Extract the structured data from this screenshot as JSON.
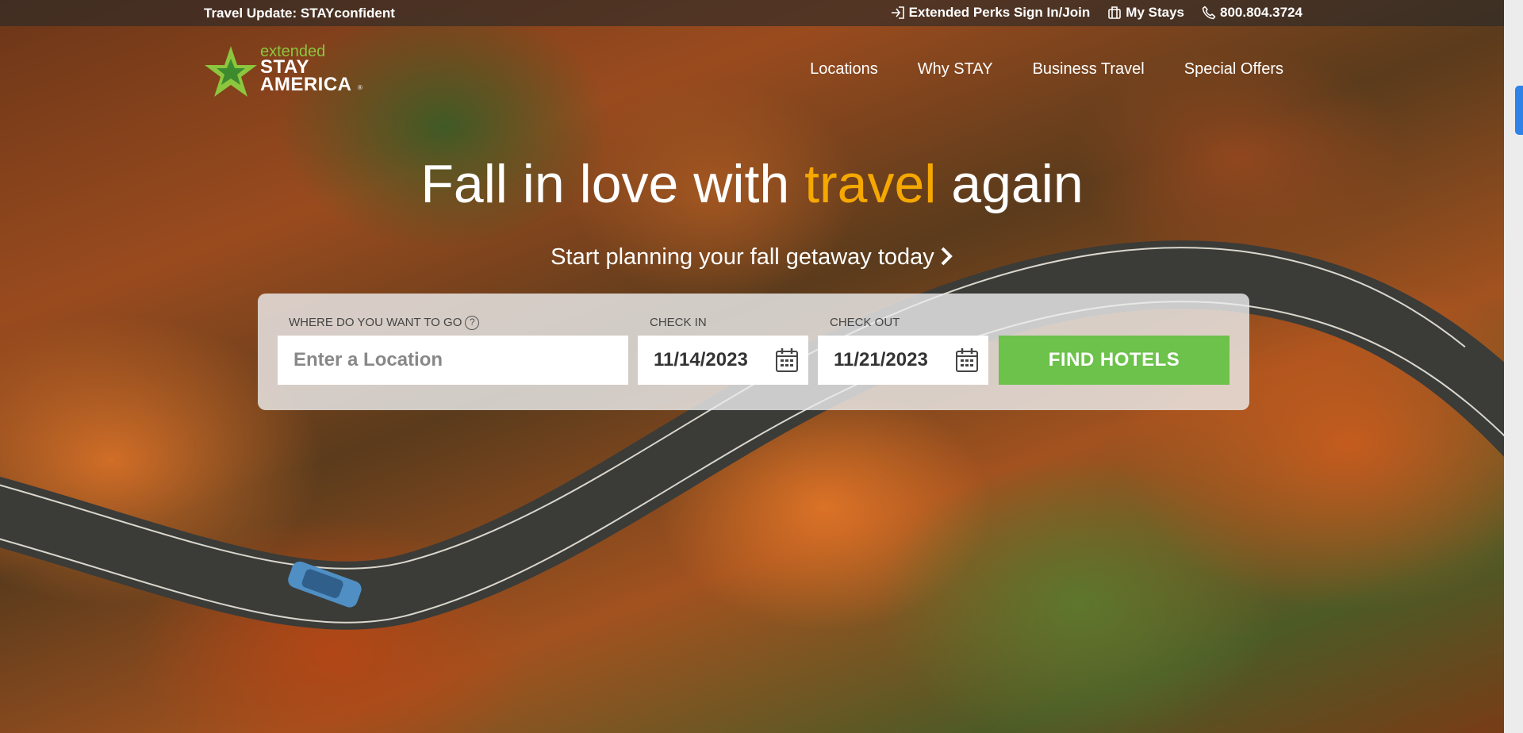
{
  "topbar": {
    "travel_update": "Travel Update: STAYconfident",
    "signin": "Extended Perks Sign In/Join",
    "my_stays": "My Stays",
    "phone": "800.804.3724"
  },
  "logo": {
    "small": "extended",
    "line1": "STAY",
    "line2": "AMERICA",
    "reg": "®"
  },
  "nav": {
    "items": [
      {
        "label": "Locations"
      },
      {
        "label": "Why STAY"
      },
      {
        "label": "Business Travel"
      },
      {
        "label": "Special Offers"
      }
    ]
  },
  "hero": {
    "title_part1": "Fall in love with ",
    "title_accent": "travel",
    "title_part2": " again",
    "subtitle": "Start planning your fall getaway today"
  },
  "search": {
    "location_label": "WHERE DO YOU WANT TO GO",
    "help": "?",
    "location_placeholder": "Enter a Location",
    "checkin_label": "CHECK IN",
    "checkin_value": "11/14/2023",
    "checkout_label": "CHECK OUT",
    "checkout_value": "11/21/2023",
    "button": "FIND HOTELS"
  },
  "colors": {
    "accent": "#f5a800",
    "brand_green": "#8cc63f",
    "button_green": "#6cc24a",
    "scroll_thumb": "#2f82e8"
  },
  "icons": {
    "signin": "sign-in-icon",
    "my_stays": "luggage-icon",
    "phone": "phone-icon",
    "calendar": "calendar-icon",
    "chevron": "chevron-right-icon",
    "help": "help-circle-icon"
  }
}
